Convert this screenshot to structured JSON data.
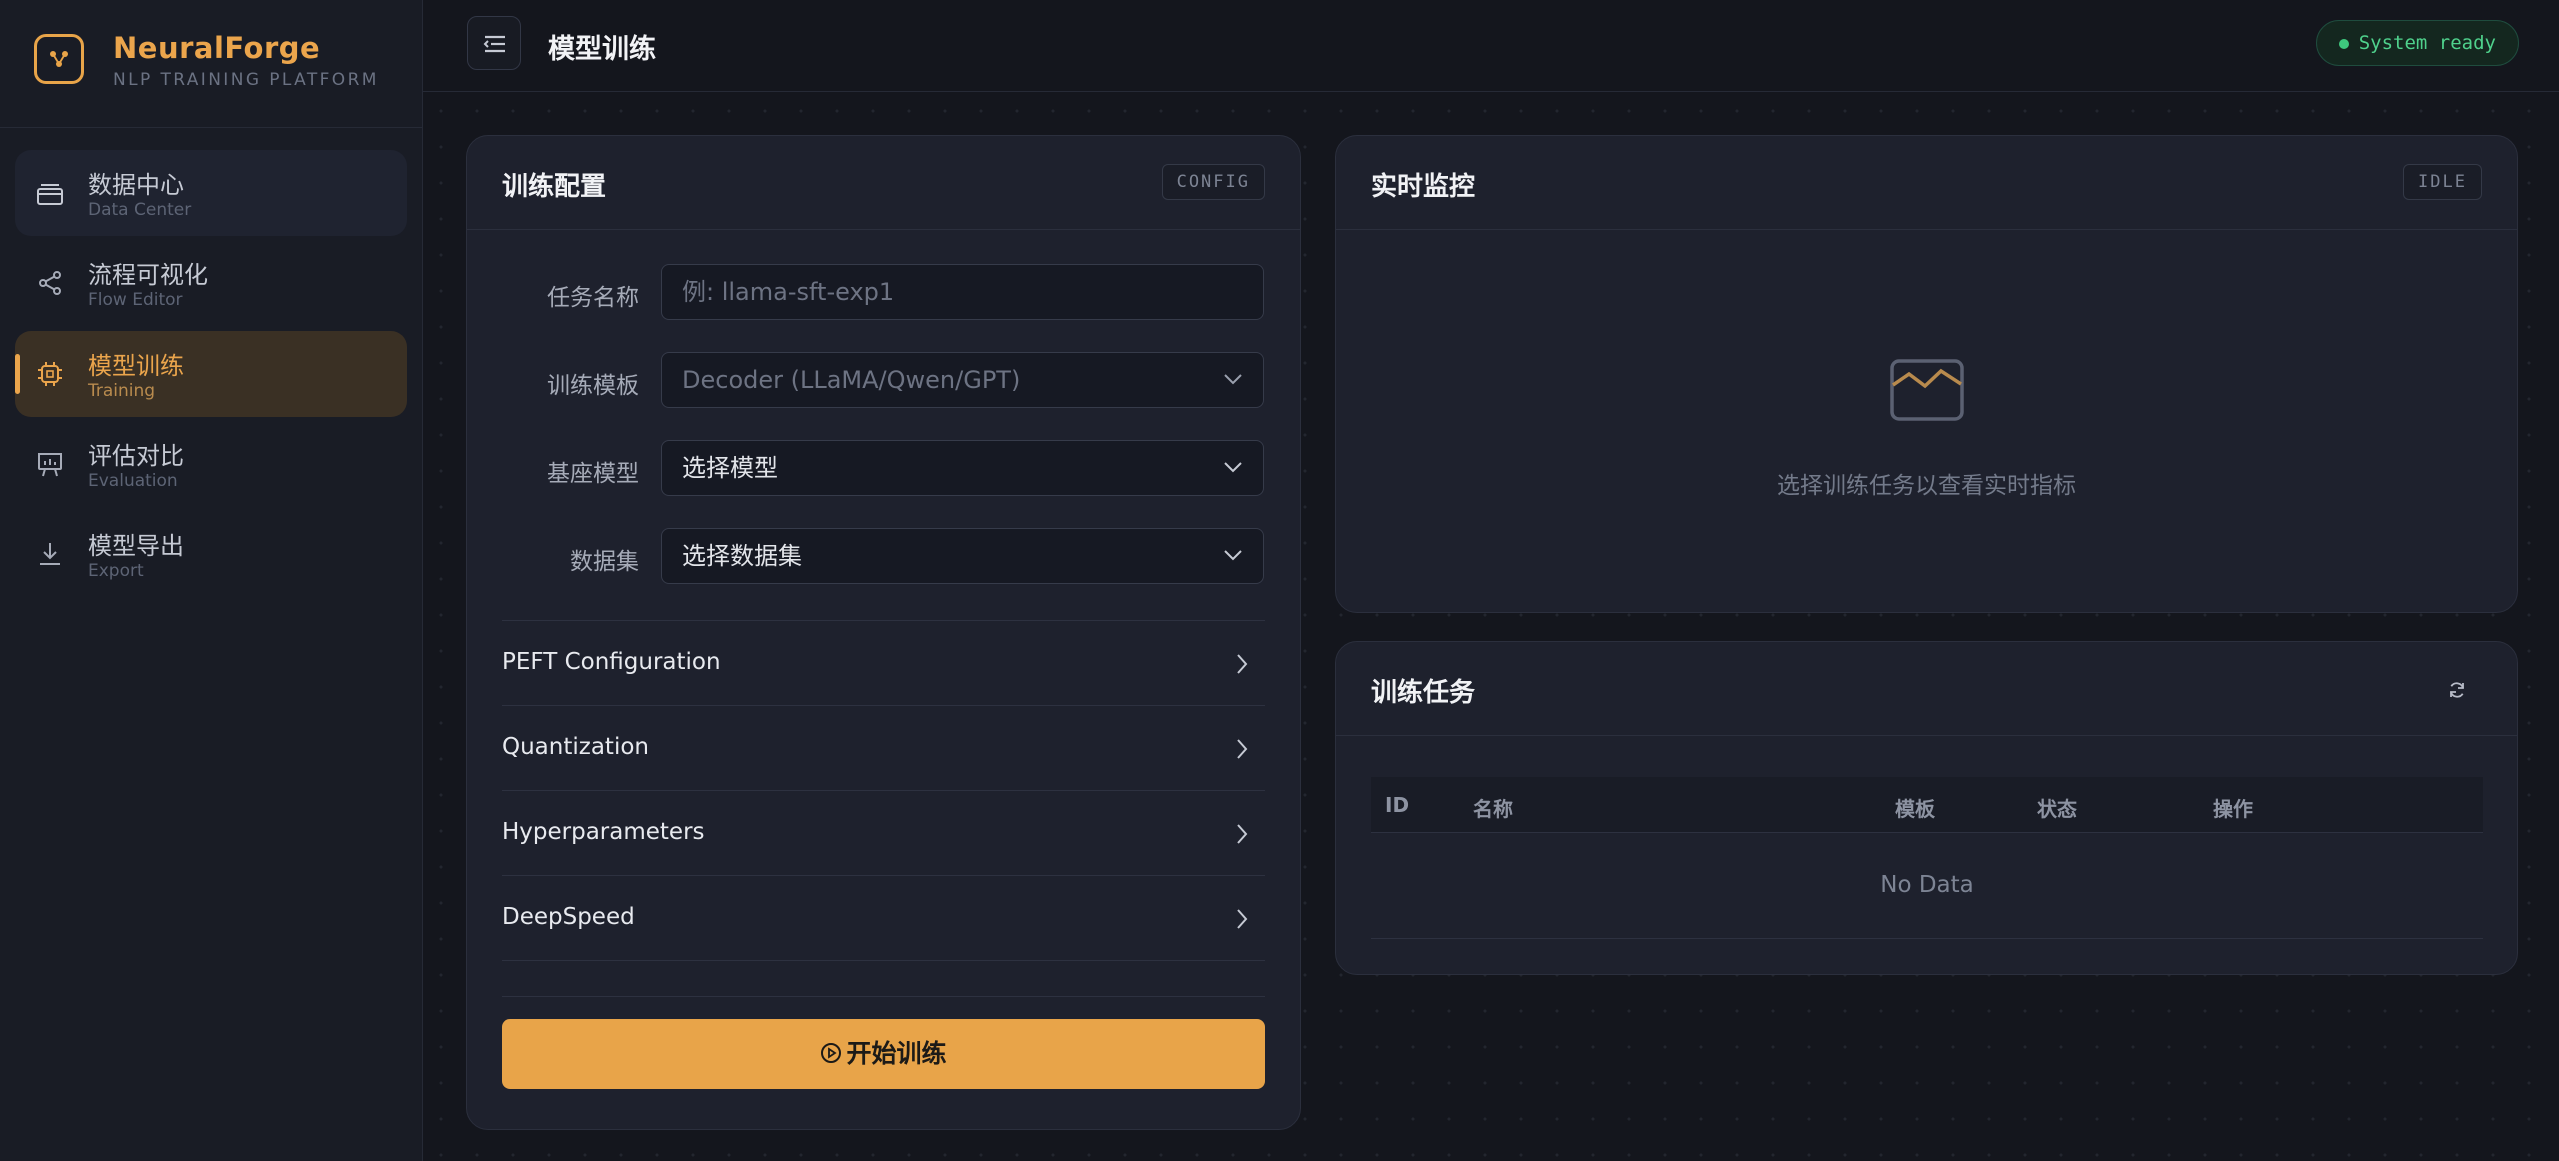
{
  "brand": {
    "name": "NeuralForge",
    "subtitle": "NLP TRAINING PLATFORM"
  },
  "nav": [
    {
      "title": "数据中心",
      "sub": "Data Center",
      "icon": "layers-icon"
    },
    {
      "title": "流程可视化",
      "sub": "Flow Editor",
      "icon": "share-icon"
    },
    {
      "title": "模型训练",
      "sub": "Training",
      "icon": "chip-icon",
      "active": true
    },
    {
      "title": "评估对比",
      "sub": "Evaluation",
      "icon": "presentation-chart-icon"
    },
    {
      "title": "模型导出",
      "sub": "Export",
      "icon": "download-icon"
    }
  ],
  "header": {
    "title": "模型训练",
    "status": "System ready"
  },
  "config": {
    "title": "训练配置",
    "tag": "CONFIG",
    "fields": {
      "task_name": {
        "label": "任务名称",
        "placeholder": "例: llama-sft-exp1"
      },
      "template": {
        "label": "训练模板",
        "value": "Decoder (LLaMA/Qwen/GPT)"
      },
      "base_model": {
        "label": "基座模型",
        "value": "选择模型"
      },
      "dataset": {
        "label": "数据集",
        "value": "选择数据集"
      }
    },
    "sections": [
      "PEFT Configuration",
      "Quantization",
      "Hyperparameters",
      "DeepSpeed"
    ],
    "start_label": "开始训练"
  },
  "monitor": {
    "title": "实时监控",
    "tag": "IDLE",
    "empty_text": "选择训练任务以查看实时指标"
  },
  "jobs": {
    "title": "训练任务",
    "columns": [
      "ID",
      "名称",
      "模板",
      "状态",
      "操作"
    ],
    "empty_text": "No Data"
  },
  "colors": {
    "accent": "#e8a449",
    "ready": "#4fd18c"
  }
}
